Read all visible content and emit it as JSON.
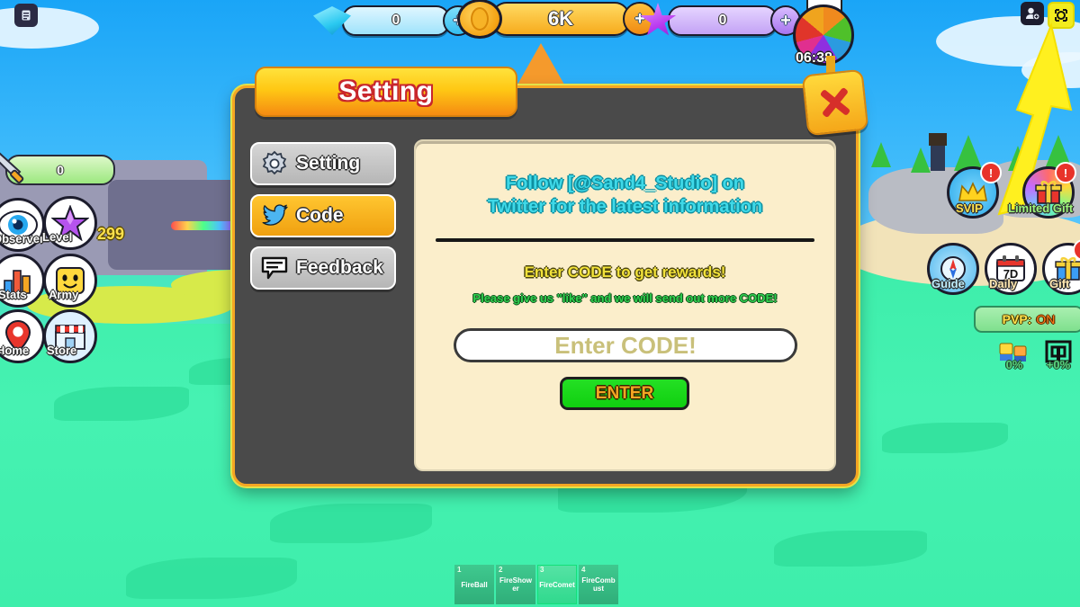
{
  "app": {
    "game_ui": "roblox-game-hud"
  },
  "topbar": {
    "notes_icon": "document-icon",
    "currencies": [
      {
        "icon": "gem-icon",
        "value": "0",
        "add": "+"
      },
      {
        "icon": "coin-icon",
        "value": "6K",
        "add": "+"
      },
      {
        "icon": "star-icon",
        "value": "0",
        "add": "+"
      }
    ],
    "spin_wheel": {
      "icon": "spin-wheel-icon",
      "timer": "06:38"
    },
    "right_icons": [
      {
        "name": "add-friend-icon",
        "highlighted": false
      },
      {
        "name": "screenshot-icon",
        "highlighted": true
      }
    ]
  },
  "left_hud": {
    "power_bar": {
      "icon": "sword-icon",
      "value": "0"
    },
    "buttons": [
      {
        "label": "Observer",
        "icon": "eye-icon"
      },
      {
        "label": "Level",
        "icon": "star-icon",
        "value": "299"
      },
      {
        "label": "Stats",
        "icon": "bar-chart-icon"
      },
      {
        "label": "Army",
        "icon": "head-icon"
      },
      {
        "label": "Home",
        "icon": "map-pin-icon"
      },
      {
        "label": "Store",
        "icon": "shop-icon"
      }
    ]
  },
  "right_hud": {
    "buttons": [
      {
        "label": "SVIP",
        "icon": "crown-icon",
        "badge": "!"
      },
      {
        "label": "Limited Gift",
        "icon": "gift-icon",
        "badge": "!"
      },
      {
        "label": "Guide",
        "icon": "compass-icon",
        "badge": ""
      },
      {
        "label": "Daily",
        "icon": "calendar-7d-icon",
        "badge": ""
      },
      {
        "label": "Gift",
        "icon": "gift-icon",
        "badge": "!"
      }
    ],
    "pvp": {
      "label": "PVP:",
      "state": "ON"
    },
    "stats": [
      {
        "icon": "players-icon",
        "value": "0%"
      },
      {
        "icon": "luck-icon",
        "value": "+0%"
      }
    ]
  },
  "hotbar": [
    {
      "key": "1",
      "label": "FireBall",
      "selected": false
    },
    {
      "key": "2",
      "label": "FireShower",
      "selected": false
    },
    {
      "key": "3",
      "label": "FireComet",
      "selected": true
    },
    {
      "key": "4",
      "label": "FireCombust",
      "selected": false
    }
  ],
  "dialog": {
    "title": "Setting",
    "close_icon": "close-x-icon",
    "nav": [
      {
        "label": "Setting",
        "icon": "gear-icon",
        "active": false
      },
      {
        "label": "Code",
        "icon": "twitter-bird-icon",
        "active": true
      },
      {
        "label": "Feedback",
        "icon": "speech-bubble-icon",
        "active": false
      }
    ],
    "content": {
      "twitter_line1": "Follow [@Sand4_Studio] on",
      "twitter_line2": "Twitter for the latest information",
      "headline": "Enter CODE to get rewards!",
      "subline": "Please give us \"like\" and we will send out more CODE!",
      "code_input_placeholder": "Enter CODE!",
      "code_input_value": "",
      "submit_label": "ENTER"
    }
  },
  "colors": {
    "panel_bg": "#4a4a4a",
    "panel_border": "#f5a623",
    "content_bg": "#fbeecb",
    "accent_orange": "#f0a010",
    "enter_green": "#16d616",
    "twitter_cyan": "#3fd9e8",
    "ground_green": "#3eeeab",
    "sky_blue": "#43bdfb"
  }
}
